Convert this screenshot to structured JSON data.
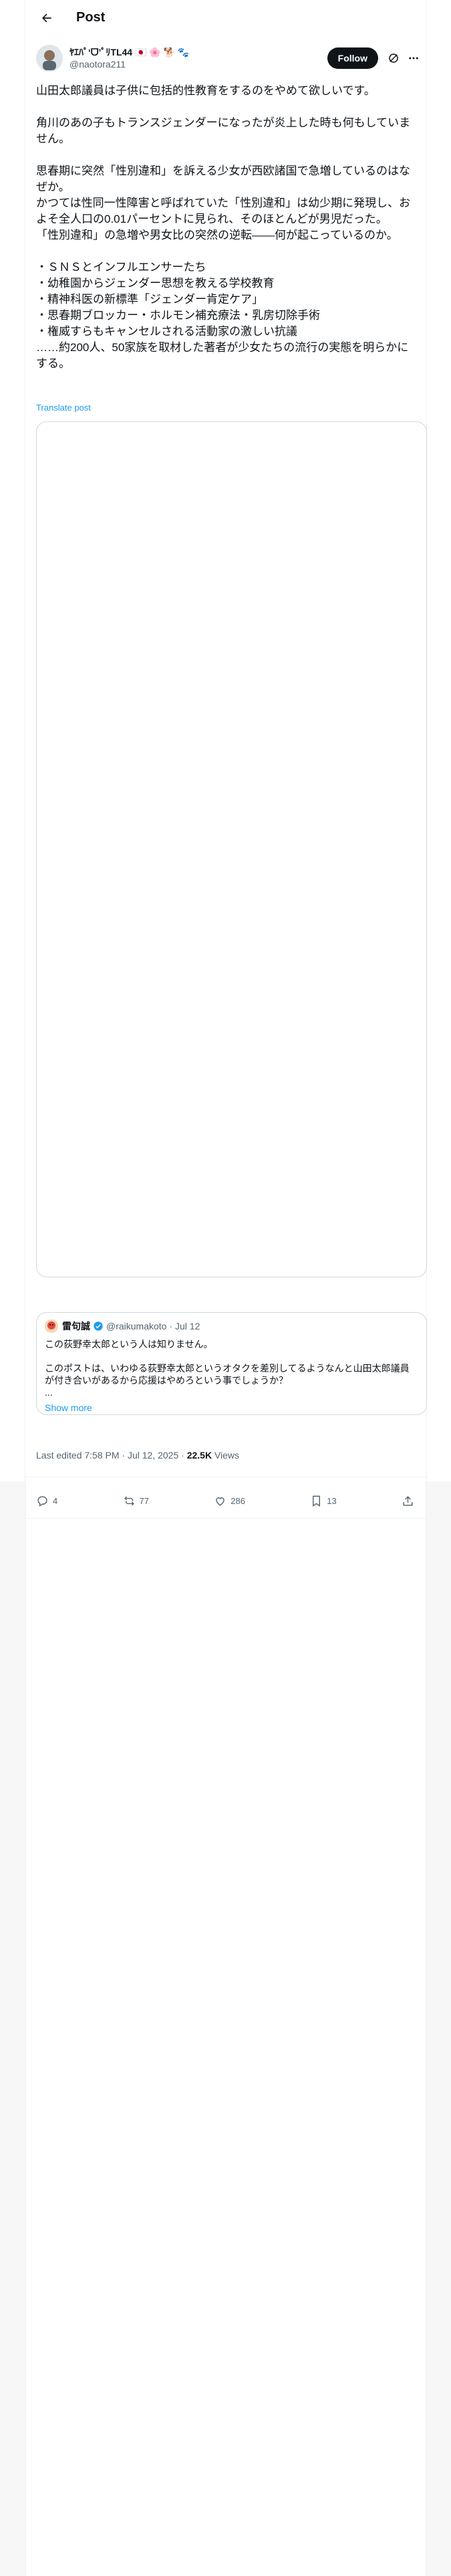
{
  "header": {
    "title": "Post"
  },
  "author": {
    "display_name": "ﾔｴﾊﾟ‘ᗜ’ﾟﾘTL44",
    "name_emoji": "🇯🇵 🌸 🐕 🐾",
    "handle": "@naotora211",
    "follow_label": "Follow"
  },
  "post": {
    "lines": [
      "山田太郎議員は子供に包括的性教育をするのをやめて欲しいです。",
      "",
      "角川のあの子もトランスジェンダーになったが炎上した時も何もしていません。",
      "",
      "思春期に突然「性別違和」を訴える少女が西欧諸国で急増しているのはなぜか。",
      "かつては性同一性障害と呼ばれていた「性別違和」は幼少期に発現し、およそ全人口の0.01パーセントに見られ、そのほとんどが男児だった。",
      "「性別違和」の急増や男女比の突然の逆転――何が起こっているのか。",
      "",
      "・ＳＮＳとインフルエンサーたち",
      "・幼稚園からジェンダー思想を教える学校教育",
      "・精神科医の新標準「ジェンダー肯定ケア」",
      "・思春期ブロッカー・ホルモン補充療法・乳房切除手術",
      "・権威すらもキャンセルされる活動家の激しい抗議",
      "……約200人、50家族を取材した著者が少女たちの流行の実態を明らかにする。"
    ],
    "translate_label": "Translate post"
  },
  "quote": {
    "name": "雷句誠",
    "handle": "@raikumakoto",
    "date": "· Jul 12",
    "lines": [
      "この荻野幸太郎という人は知りません。",
      "",
      "このポストは、いわゆる荻野幸太郎というオタクを差別してるようなんと山田太郎議員が付き合いがあるから応援はやめろという事でしょうか？",
      "..."
    ],
    "show_more": "Show more"
  },
  "meta": {
    "prefix": "Last edited 7:58 PM · Jul 12, 2025 · ",
    "views_count": "22.5K",
    "views_label": " Views"
  },
  "actions": {
    "replies": "4",
    "reposts": "77",
    "likes": "286",
    "bookmarks": "13"
  },
  "colors": {
    "accent": "#1d9bf0",
    "text": "#0f1419",
    "muted": "#536471",
    "border": "#cfd9de"
  }
}
